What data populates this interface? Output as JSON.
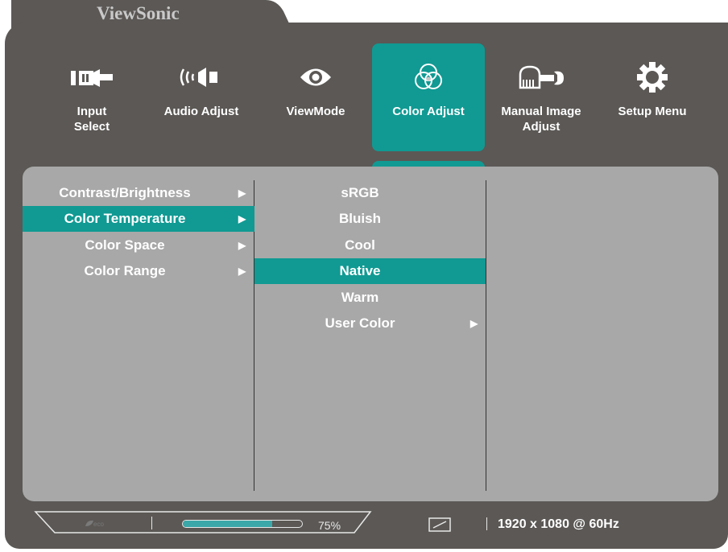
{
  "header": {
    "brand": "ViewSonic"
  },
  "main_menu": {
    "items": [
      {
        "label": "Input Select",
        "icon": "input-select-icon",
        "active": false
      },
      {
        "label": "Audio Adjust",
        "icon": "speaker-icon",
        "active": false
      },
      {
        "label": "ViewMode",
        "icon": "eye-icon",
        "active": false
      },
      {
        "label": "Color Adjust",
        "icon": "color-circles-icon",
        "active": true
      },
      {
        "label": "Manual Image Adjust",
        "icon": "hand-wrench-icon",
        "active": false
      },
      {
        "label": "Setup Menu",
        "icon": "gear-icon",
        "active": false
      }
    ]
  },
  "submenu": {
    "items": [
      {
        "label": "Contrast/Brightness",
        "selected": false
      },
      {
        "label": "Color Temperature",
        "selected": true
      },
      {
        "label": "Color Space",
        "selected": false
      },
      {
        "label": "Color Range",
        "selected": false
      }
    ]
  },
  "options": {
    "items": [
      {
        "label": "sRGB",
        "selected": false
      },
      {
        "label": "Bluish",
        "selected": false
      },
      {
        "label": "Cool",
        "selected": false
      },
      {
        "label": "Native",
        "selected": true
      },
      {
        "label": "Warm",
        "selected": false
      },
      {
        "label": "User Color",
        "selected": false
      }
    ]
  },
  "status": {
    "eco_label": "eco",
    "progress_text": "75%",
    "progress_value": 0.75,
    "resolution": "1920 x 1080 @ 60Hz"
  },
  "colors": {
    "accent": "#109a93",
    "panel": "#5b5855",
    "content": "#a8a8a8"
  }
}
